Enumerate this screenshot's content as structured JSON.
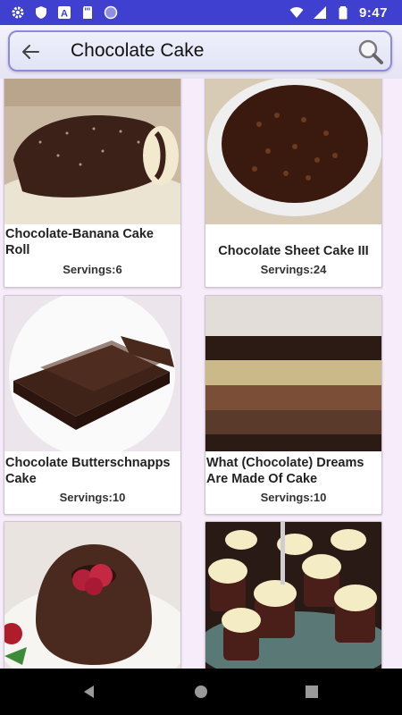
{
  "status_bar": {
    "time": "9:47"
  },
  "search": {
    "query": "Chocolate Cake"
  },
  "recipes": [
    {
      "title": "Chocolate-Banana Cake Roll",
      "servings": "Servings:6"
    },
    {
      "title": "Chocolate Sheet Cake III",
      "servings": "Servings:24"
    },
    {
      "title": "Chocolate Butterschnapps Cake",
      "servings": "Servings:10"
    },
    {
      "title": "What (Chocolate) Dreams Are Made Of Cake",
      "servings": "Servings:10"
    }
  ],
  "colors": {
    "status_bar": "#3f3fd0",
    "background": "#f7ecf9",
    "search_border": "#8e8ad8"
  }
}
